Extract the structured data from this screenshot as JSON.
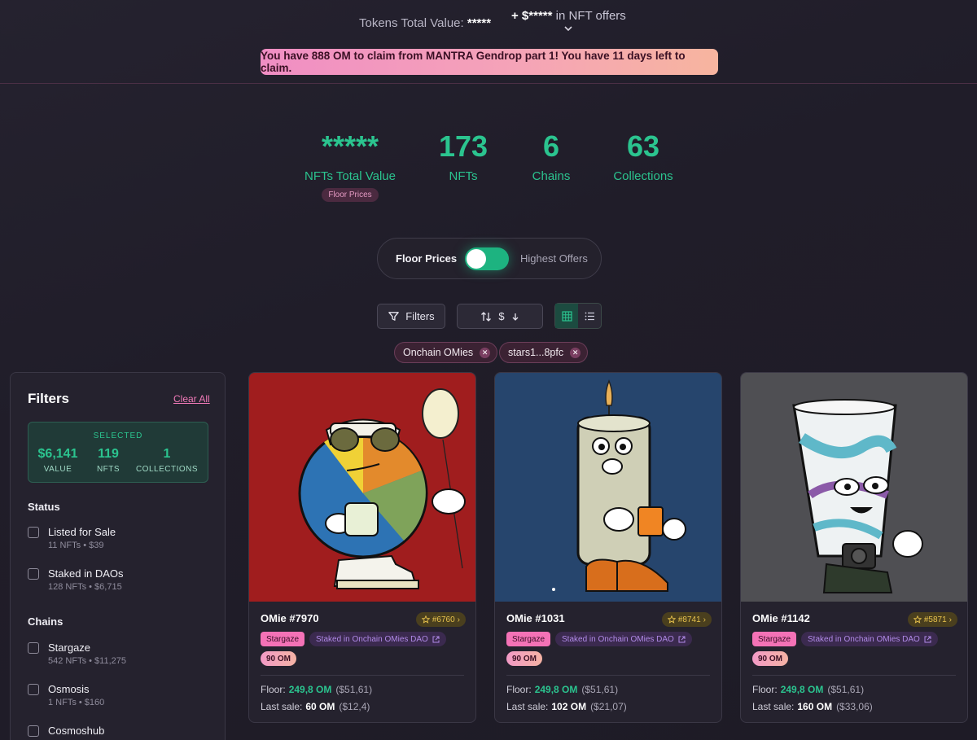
{
  "header": {
    "tokens_label": "Tokens Total Value:",
    "tokens_value": "*****",
    "offers_prefix": "+ $*****",
    "offers_suffix": "in NFT offers",
    "banner": "You have 888 OM to claim from MANTRA Gendrop part 1! You have 11 days left to claim."
  },
  "stats": [
    {
      "value": "*****",
      "label": "NFTs Total Value",
      "tag": "Floor Prices"
    },
    {
      "value": "173",
      "label": "NFTs"
    },
    {
      "value": "6",
      "label": "Chains"
    },
    {
      "value": "63",
      "label": "Collections"
    }
  ],
  "price_toggle": {
    "left": "Floor Prices",
    "right": "Highest Offers",
    "state": "on"
  },
  "controls": {
    "filters_label": "Filters",
    "sort_label": "$"
  },
  "active_chips": [
    {
      "label": "Onchain OMies"
    },
    {
      "label": "stars1...8pfc"
    }
  ],
  "filters": {
    "title": "Filters",
    "clear_label": "Clear All",
    "selected": {
      "caption": "SELECTED",
      "value": "$6,141",
      "value_label": "VALUE",
      "nfts": "119",
      "nfts_label": "NFTS",
      "collections": "1",
      "collections_label": "COLLECTIONS"
    },
    "status_title": "Status",
    "status": [
      {
        "name": "Listed for Sale",
        "sub": "11 NFTs • $39"
      },
      {
        "name": "Staked in DAOs",
        "sub": "128 NFTs • $6,715"
      }
    ],
    "chains_title": "Chains",
    "chains": [
      {
        "name": "Stargaze",
        "sub": "542 NFTs • $11,275"
      },
      {
        "name": "Osmosis",
        "sub": "1 NFTs • $160"
      },
      {
        "name": "Cosmoshub",
        "sub": ""
      }
    ]
  },
  "cards": [
    {
      "name": "OMie #7970",
      "rank": "#6760",
      "chain": "Stargaze",
      "staked": "Staked in Onchain OMies DAO",
      "price_tag": "90 OM",
      "floor_label": "Floor:",
      "floor": "249,8 OM",
      "floor_usd": "($51,61)",
      "last_label": "Last sale:",
      "last": "60 OM",
      "last_usd": "($12,4)",
      "bg": "#a01d1e"
    },
    {
      "name": "OMie #1031",
      "rank": "#8741",
      "chain": "Stargaze",
      "staked": "Staked in Onchain OMies DAO",
      "price_tag": "90 OM",
      "floor_label": "Floor:",
      "floor": "249,8 OM",
      "floor_usd": "($51,61)",
      "last_label": "Last sale:",
      "last": "102 OM",
      "last_usd": "($21,07)",
      "bg": "#26456d"
    },
    {
      "name": "OMie #1142",
      "rank": "#5871",
      "chain": "Stargaze",
      "staked": "Staked in Onchain OMies DAO",
      "price_tag": "90 OM",
      "floor_label": "Floor:",
      "floor": "249,8 OM",
      "floor_usd": "($51,61)",
      "last_label": "Last sale:",
      "last": "160 OM",
      "last_usd": "($33,06)",
      "bg": "#4f4f53"
    }
  ]
}
